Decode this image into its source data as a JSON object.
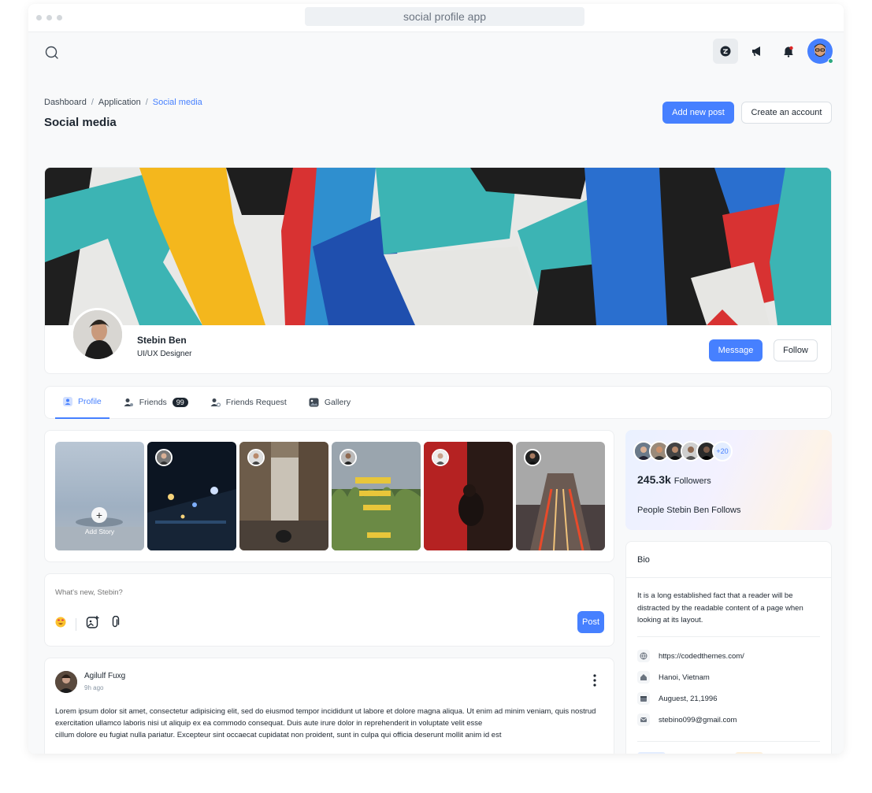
{
  "window": {
    "title": "social profile app"
  },
  "breadcrumb": {
    "items": [
      "Dashboard",
      "Application",
      "Social media"
    ],
    "separator": "/"
  },
  "page": {
    "title": "Social media"
  },
  "header_actions": {
    "add_post": "Add new post",
    "create_account": "Create an account"
  },
  "profile": {
    "name": "Stebin Ben",
    "role": "UI/UX Designer",
    "message": "Message",
    "follow": "Follow"
  },
  "tabs": [
    {
      "label": "Profile",
      "icon": "user-icon",
      "active": true
    },
    {
      "label": "Friends",
      "icon": "users-icon",
      "badge": "99"
    },
    {
      "label": "Friends Request",
      "icon": "user-request-icon"
    },
    {
      "label": "Gallery",
      "icon": "gallery-icon"
    }
  ],
  "stories": {
    "add_label": "Add Story",
    "add_icon": "+"
  },
  "followers": {
    "more": "+20",
    "count": "245.3k",
    "count_label": "Followers",
    "follows_label": "People Stebin Ben Follows"
  },
  "composer": {
    "placeholder": "What's new, Stebin?",
    "post": "Post"
  },
  "feed": {
    "author": "Agilulf Fuxg",
    "time": "9h ago",
    "body_line1": "Lorem ipsum dolor sit amet, consectetur adipisicing elit, sed do eiusmod tempor incididunt ut labore et dolore magna aliqua. Ut enim ad minim veniam, quis nostrud exercitation ullamco laboris nisi ut aliquip ex ea commodo  consequat. Duis aute irure dolor in reprehenderit in voluptate velit esse",
    "body_line2": "cillum dolore eu fugiat nulla pariatur. Excepteur sint occaecat cupidatat non proident, sunt in culpa qui officia deserunt mollit anim id est"
  },
  "bio": {
    "title": "Bio",
    "text": "It is a long established fact that a reader will be distracted by the readable content of a page when looking at its layout.",
    "website": "https://codedthemes.com/",
    "location": "Hanoi, Vietnam",
    "date": "Auguest, 21,1996",
    "email": "stebino099@gmail.com"
  },
  "colors": {
    "accent": "#4680ff",
    "text": "#1d2630",
    "muted": "#8996a4",
    "border": "#eceef0"
  }
}
